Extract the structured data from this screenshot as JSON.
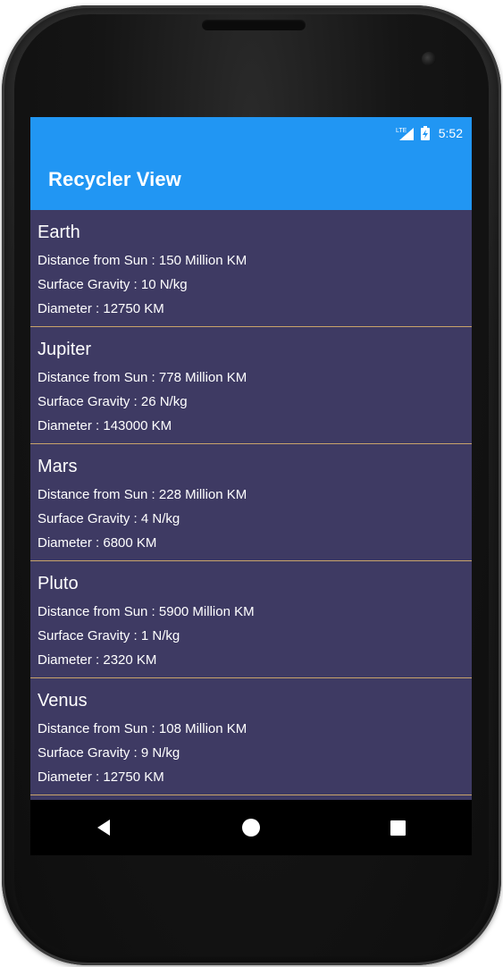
{
  "statusbar": {
    "network_icon": "lte-signal-icon",
    "battery_icon": "battery-charging-icon",
    "network_label": "LTE",
    "time": "5:52"
  },
  "toolbar": {
    "title": "Recycler View"
  },
  "planets": [
    {
      "name": "Earth",
      "distance": "Distance from Sun : 150 Million KM",
      "gravity": "Surface Gravity : 10 N/kg",
      "diameter": "Diameter : 12750 KM"
    },
    {
      "name": "Jupiter",
      "distance": "Distance from Sun : 778 Million KM",
      "gravity": "Surface Gravity : 26 N/kg",
      "diameter": "Diameter : 143000 KM"
    },
    {
      "name": "Mars",
      "distance": "Distance from Sun : 228 Million KM",
      "gravity": "Surface Gravity : 4 N/kg",
      "diameter": "Diameter : 6800 KM"
    },
    {
      "name": "Pluto",
      "distance": "Distance from Sun : 5900 Million KM",
      "gravity": "Surface Gravity : 1 N/kg",
      "diameter": "Diameter : 2320 KM"
    },
    {
      "name": "Venus",
      "distance": "Distance from Sun : 108 Million KM",
      "gravity": "Surface Gravity : 9 N/kg",
      "diameter": "Diameter : 12750 KM"
    }
  ],
  "navbar": {
    "back_icon": "back-triangle-icon",
    "home_icon": "home-circle-icon",
    "recents_icon": "recents-square-icon"
  },
  "colors": {
    "app_bar": "#2196f3",
    "list_background": "#3e3a63",
    "divider": "#c9a46a",
    "navbar": "#000000",
    "text": "#ffffff"
  }
}
